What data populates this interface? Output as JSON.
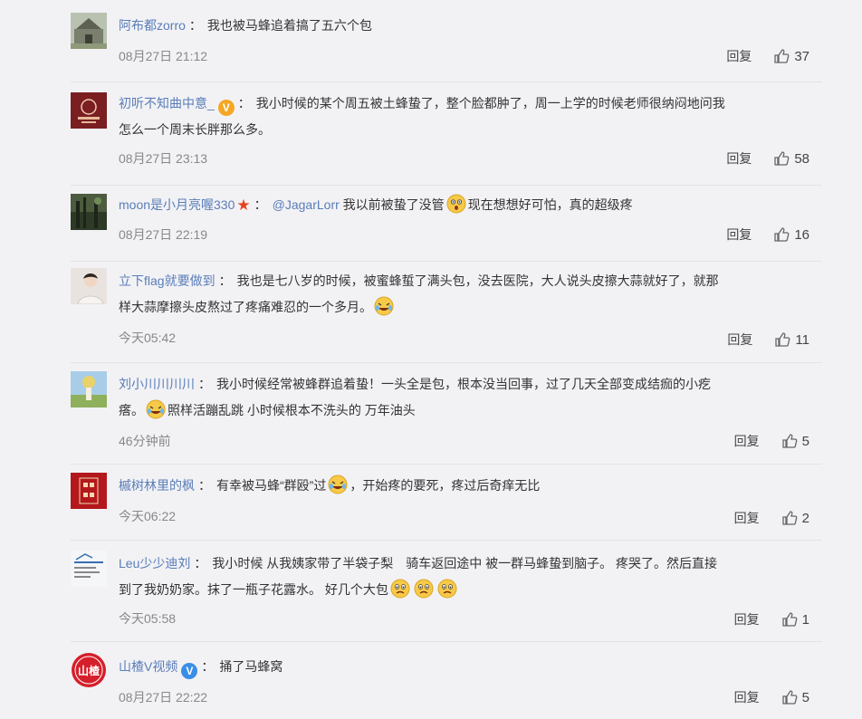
{
  "comments": [
    {
      "user": "阿布都zorro",
      "text": "我也被马蜂追着搞了五六个包",
      "time": "08月27日 21:12",
      "reply": "回复",
      "likes": "37"
    },
    {
      "user": "初听不知曲中意_",
      "badge": "V",
      "text_line1": "我小时候的某个周五被土蜂蛰了，整个脸都肿了，周一上学的时候老师很纳闷地问我",
      "text_line2": "怎么一个周末长胖那么多。",
      "time": "08月27日 23:13",
      "reply": "回复",
      "likes": "58"
    },
    {
      "user": "moon是小月亮喔330",
      "mention": "@JagarLorr",
      "text_a": "我以前被蛰了没管",
      "text_b": "现在想想好可怕，真的超级疼",
      "time": "08月27日 22:19",
      "reply": "回复",
      "likes": "16"
    },
    {
      "user": "立下flag就要做到",
      "text_line1": "我也是七八岁的时候，被蜜蜂蜇了满头包，没去医院，大人说头皮擦大蒜就好了，就那",
      "text_line2": "样大蒜摩擦头皮熬过了疼痛难忍的一个多月。",
      "time": "今天05:42",
      "reply": "回复",
      "likes": "11"
    },
    {
      "user": "刘小川川川川",
      "text_line1": "我小时候经常被蜂群追着蛰！一头全是包，根本没当回事，过了几天全部变成结痂的小疙",
      "text_line2a": "瘩。",
      "text_line2b": "照样活蹦乱跳 小时候根本不洗头的 万年油头",
      "time": "46分钟前",
      "reply": "回复",
      "likes": "5"
    },
    {
      "user": "槭树林里的枫",
      "text_a": "有幸被马蜂“群殴”过",
      "text_b": "，开始疼的要死，疼过后奇痒无比",
      "time": "今天06:22",
      "reply": "回复",
      "likes": "2"
    },
    {
      "user": "Leu少少迪刘",
      "text_line1": "我小时候 从我姨家带了半袋子梨　骑车返回途中 被一群马蜂蛰到脑子。 疼哭了。然后直接",
      "text_line2": "到了我奶奶家。抹了一瓶子花露水。 好几个大包",
      "time": "今天05:58",
      "reply": "回复",
      "likes": "1"
    },
    {
      "user": "山楂V视频",
      "badge": "V",
      "text": "捅了马蜂窝",
      "avatar_text": "山楂",
      "time": "08月27日 22:22",
      "reply": "回复",
      "likes": "5"
    }
  ],
  "colors": {
    "link": "#5a7db8",
    "text": "#333333",
    "muted": "#888888",
    "background": "#f2f2f5"
  },
  "icons": {
    "like": "thumbs-up-icon",
    "verified": "verified-badge-icon",
    "star": "star-icon"
  }
}
